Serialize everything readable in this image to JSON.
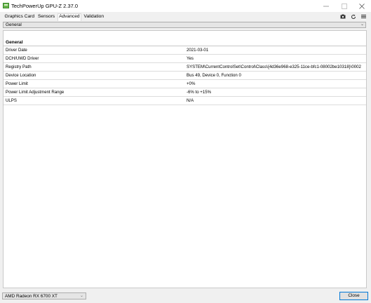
{
  "window": {
    "title": "TechPowerUp GPU-Z 2.37.0",
    "accent_color": "#0078d7"
  },
  "tabs": [
    {
      "label": "Graphics Card",
      "active": false
    },
    {
      "label": "Sensors",
      "active": false
    },
    {
      "label": "Advanced",
      "active": true
    },
    {
      "label": "Validation",
      "active": false
    }
  ],
  "toolbar_icons": [
    "camera-icon",
    "refresh-icon",
    "menu-icon"
  ],
  "section_dropdown": {
    "selected": "General"
  },
  "panel": {
    "header": "General",
    "rows": [
      {
        "key": "Driver Date",
        "value": "2021-03-01"
      },
      {
        "key": "DCH/UWD Driver",
        "value": "Yes"
      },
      {
        "key": "Registry Path",
        "value": "SYSTEM\\CurrentControlSet\\Control\\Class\\{4d36e968-e325-11ce-bfc1-08002be10318}\\0002"
      },
      {
        "key": "Device Location",
        "value": "Bus 49, Device 0, Function 0"
      },
      {
        "key": "Power Limit",
        "value": "+0%"
      },
      {
        "key": "Power Limit Adjustment Range",
        "value": "-6% to +15%"
      },
      {
        "key": "ULPS",
        "value": "N/A"
      }
    ]
  },
  "gpu_dropdown": {
    "selected": "AMD Radeon RX 6700 XT"
  },
  "close_button": {
    "label": "Close"
  }
}
